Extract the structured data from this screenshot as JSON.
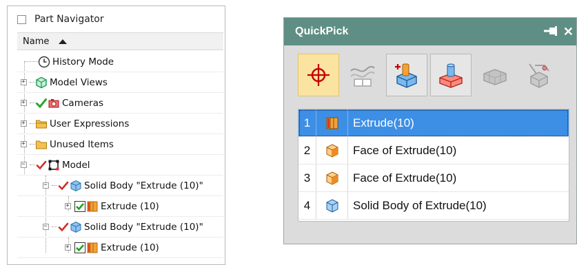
{
  "part_navigator": {
    "title": "Part Navigator",
    "column_name": "Name",
    "items": [
      {
        "label": "History Mode",
        "icon": "clock-icon",
        "expander": ""
      },
      {
        "label": "Model Views",
        "icon": "model-views-icon",
        "expander": "+"
      },
      {
        "label": "Cameras",
        "icon": "camera-icon",
        "expander": "+"
      },
      {
        "label": "User Expressions",
        "icon": "folder-icon",
        "expander": "+"
      },
      {
        "label": "Unused Items",
        "icon": "folder-icon",
        "expander": "+"
      },
      {
        "label": "Model",
        "icon": "model-icon",
        "expander": "−"
      },
      {
        "label": "Solid Body \"Extrude (10)\"",
        "icon": "solid-body-icon",
        "expander": "−"
      },
      {
        "label": "Extrude (10)",
        "icon": "extrude-icon",
        "expander": "+"
      },
      {
        "label": "Solid Body \"Extrude (10)\"",
        "icon": "solid-body-icon",
        "expander": "−"
      },
      {
        "label": "Extrude (10)",
        "icon": "extrude-icon",
        "expander": "+"
      }
    ]
  },
  "quickpick": {
    "title": "QuickPick",
    "pin_symbol": "⊣",
    "close_symbol": "✕",
    "filters": [
      {
        "name": "all-filter",
        "icon": "crosshair-icon"
      },
      {
        "name": "curve-filter",
        "icon": "curve-icon"
      },
      {
        "name": "feature-filter",
        "icon": "feature-icon"
      },
      {
        "name": "body-filter",
        "icon": "body-icon"
      },
      {
        "name": "component-filter",
        "icon": "component-icon"
      },
      {
        "name": "other-filter",
        "icon": "other-icon"
      }
    ],
    "rows": [
      {
        "index": "1",
        "label": "Extrude(10)",
        "icon": "extrude-icon",
        "selected": true
      },
      {
        "index": "2",
        "label": "Face of Extrude(10)",
        "icon": "face-icon",
        "selected": false
      },
      {
        "index": "3",
        "label": "Face of Extrude(10)",
        "icon": "face-icon",
        "selected": false
      },
      {
        "index": "4",
        "label": "Solid Body of Extrude(10)",
        "icon": "solid-body-icon",
        "selected": false
      }
    ]
  },
  "colors": {
    "title_bar": "#5f8e84",
    "selection": "#3d8fe6",
    "active_filter": "#fbe3a1"
  }
}
